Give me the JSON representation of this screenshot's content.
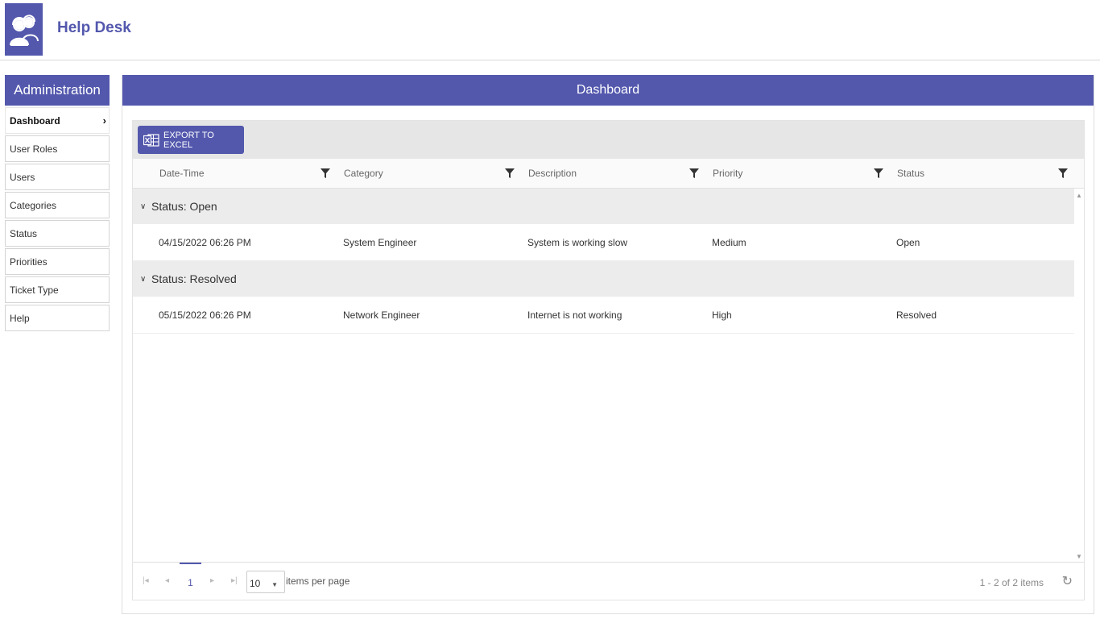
{
  "app": {
    "title": "Help Desk",
    "logo_icon": "support-agents-icon",
    "accent": "#5358ad"
  },
  "sidebar": {
    "header": "Administration",
    "items": [
      {
        "label": "Dashboard",
        "active": true
      },
      {
        "label": "User Roles"
      },
      {
        "label": "Users"
      },
      {
        "label": "Categories"
      },
      {
        "label": "Status"
      },
      {
        "label": "Priorities"
      },
      {
        "label": "Ticket Type"
      },
      {
        "label": "Help"
      }
    ]
  },
  "main": {
    "title": "Dashboard",
    "toolbar": {
      "export_label": "EXPORT TO EXCEL",
      "export_icon": "excel-icon"
    },
    "columns": [
      "Date-Time",
      "Category",
      "Description",
      "Priority",
      "Status"
    ],
    "groups": [
      {
        "label": "Status: Open",
        "rows": [
          [
            "04/15/2022 06:26 PM",
            "System Engineer",
            "System is working slow",
            "Medium",
            "Open"
          ]
        ]
      },
      {
        "label": "Status: Resolved",
        "rows": [
          [
            "05/15/2022 06:26 PM",
            "Network Engineer",
            "Internet is not working",
            "High",
            "Resolved"
          ]
        ]
      }
    ],
    "pager": {
      "current_page": "1",
      "page_size": "10",
      "page_size_label": "items per page",
      "info": "1 - 2 of 2 items"
    }
  }
}
